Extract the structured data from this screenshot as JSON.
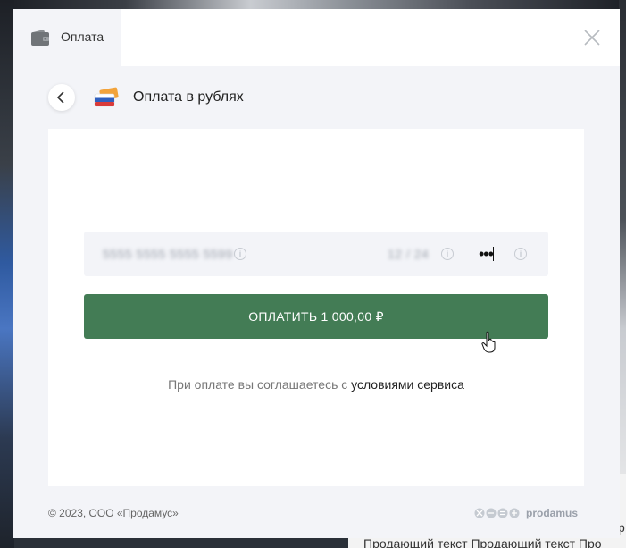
{
  "background": {
    "marquee_fragment": "р",
    "marquee_text": "Продающий текст Продающий текст Про"
  },
  "modal": {
    "tab": {
      "label": "Оплата",
      "icon": "wallet-icon"
    },
    "close_icon": "close-icon",
    "back_icon": "chevron-left-icon",
    "method_icon": "rub-cards-icon",
    "method_title": "Оплата в рублях",
    "card_form": {
      "card_number_value": "5555 5555 5555 5599",
      "expiry_value": "12 / 24",
      "cvc_value": "•••",
      "info_icon_glyph": "i"
    },
    "pay_button_label": "ОПЛАТИТЬ 1 000,00 ₽",
    "agreement_text": "При оплате вы соглашаетесь с ",
    "agreement_link": "условиями сервиса",
    "footer": {
      "copyright": "© 2023, ООО «Продамус»",
      "brand": "prodamus"
    },
    "colors": {
      "pay_button": "#437c55",
      "modal_bg": "#f3f4f8"
    }
  }
}
